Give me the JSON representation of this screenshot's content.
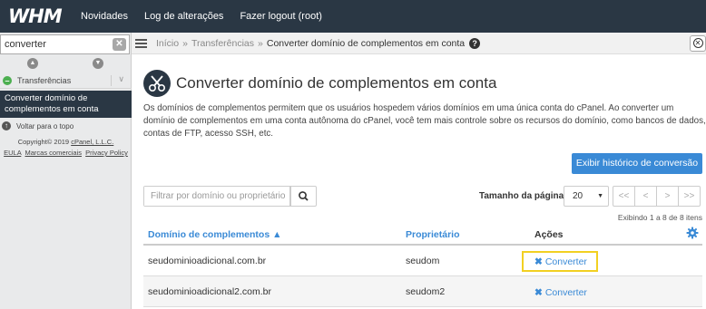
{
  "topbar": {
    "logo": "WHM",
    "nav": [
      "Novidades",
      "Log de alterações",
      "Fazer logout (root)"
    ]
  },
  "sidebar": {
    "search_value": "converter",
    "category": "Transferências",
    "active_item": "Converter domínio de complementos em conta",
    "back_to_top": "Voltar para o topo",
    "copyright": "Copyright© 2019",
    "cpanel_link": "cPanel, L.L.C.",
    "eula": "EULA",
    "trademarks": "Marcas comerciais",
    "privacy": "Privacy Policy"
  },
  "breadcrumb": {
    "home": "Início",
    "section": "Transferências",
    "current": "Converter domínio de complementos em conta"
  },
  "main": {
    "title": "Converter domínio de complementos em conta",
    "description": "Os domínios de complementos permitem que os usuários hospedem vários domínios em uma única conta do cPanel. Ao converter um domínio de complementos em uma conta autônoma do cPanel, você tem mais controle sobre os recursos do domínio, como bancos de dados, contas de FTP, acesso SSH, etc.",
    "history_button": "Exibir histórico de conversão",
    "filter_placeholder": "Filtrar por domínio ou proprietário",
    "page_size_label": "Tamanho da página",
    "page_size_value": "20",
    "pager": [
      "<<",
      "<",
      ">",
      ">>"
    ],
    "showing": "Exibindo 1 a 8 de 8 itens",
    "columns": {
      "domain": "Domínio de complementos ▲",
      "owner": "Proprietário",
      "actions": "Ações"
    },
    "rows": [
      {
        "domain": "seudominioadicional.com.br",
        "owner": "seudom",
        "action": "Converter"
      },
      {
        "domain": "seudominioadicional2.com.br",
        "owner": "seudom2",
        "action": "Converter"
      }
    ]
  },
  "colors": {
    "topbar": "#2a3744",
    "accent": "#3a8ad6",
    "highlight": "#f2d022"
  }
}
